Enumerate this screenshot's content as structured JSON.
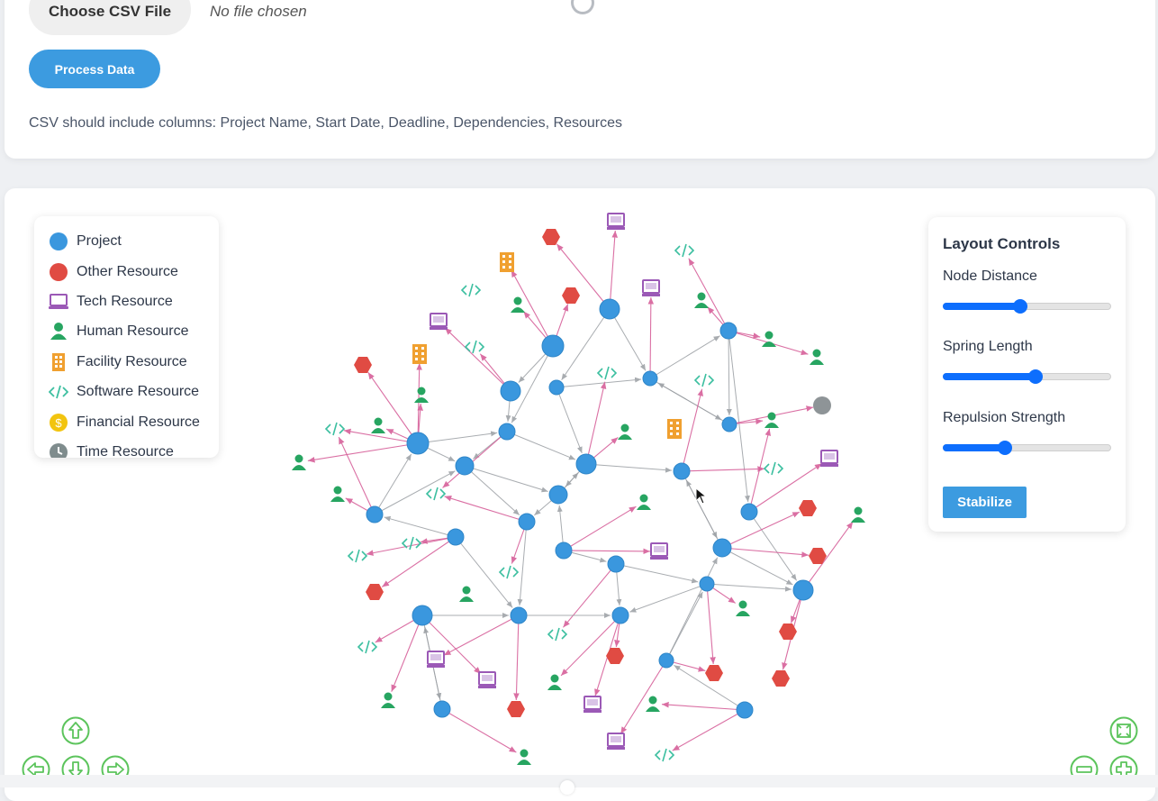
{
  "upload": {
    "choose_label": "Choose CSV File",
    "file_status": "No file chosen",
    "process_label": "Process Data",
    "hint": "CSV should include columns: Project Name, Start Date, Deadline, Dependencies, Resources"
  },
  "legend": {
    "items": [
      {
        "label": "Project",
        "icon": "project-circle-icon",
        "color": "#3a97de"
      },
      {
        "label": "Other Resource",
        "icon": "other-resource-circle-icon",
        "color": "#e04b43"
      },
      {
        "label": "Tech Resource",
        "icon": "computer-icon",
        "color": "#9b59b6"
      },
      {
        "label": "Human Resource",
        "icon": "person-icon",
        "color": "#27a561"
      },
      {
        "label": "Facility Resource",
        "icon": "building-icon",
        "color": "#f0a030"
      },
      {
        "label": "Software Resource",
        "icon": "code-icon",
        "color": "#3cbfa0"
      },
      {
        "label": "Financial Resource",
        "icon": "dollar-icon",
        "color": "#f2c40f"
      },
      {
        "label": "Time Resource",
        "icon": "clock-icon",
        "color": "#7f8c8d"
      }
    ]
  },
  "controls": {
    "title": "Layout Controls",
    "node_distance_label": "Node Distance",
    "node_distance": 0.46,
    "spring_length_label": "Spring Length",
    "spring_length": 0.55,
    "repulsion_label": "Repulsion Strength",
    "repulsion": 0.37,
    "stabilize_label": "Stabilize"
  },
  "colors": {
    "project": "#3a97de",
    "other": "#e04b43",
    "tech": "#9b59b6",
    "human": "#27a561",
    "facility": "#f0a030",
    "software": "#3cbfa0",
    "time": "#8e9497",
    "edge_project": "#9a9ea3",
    "edge_resource": "#d6609a",
    "nav": "#5cc45c"
  },
  "navigation": [
    "up-arrow-icon",
    "left-arrow-icon",
    "down-arrow-icon",
    "right-arrow-icon",
    "fit-view-icon",
    "zoom-out-icon",
    "zoom-in-icon"
  ]
}
